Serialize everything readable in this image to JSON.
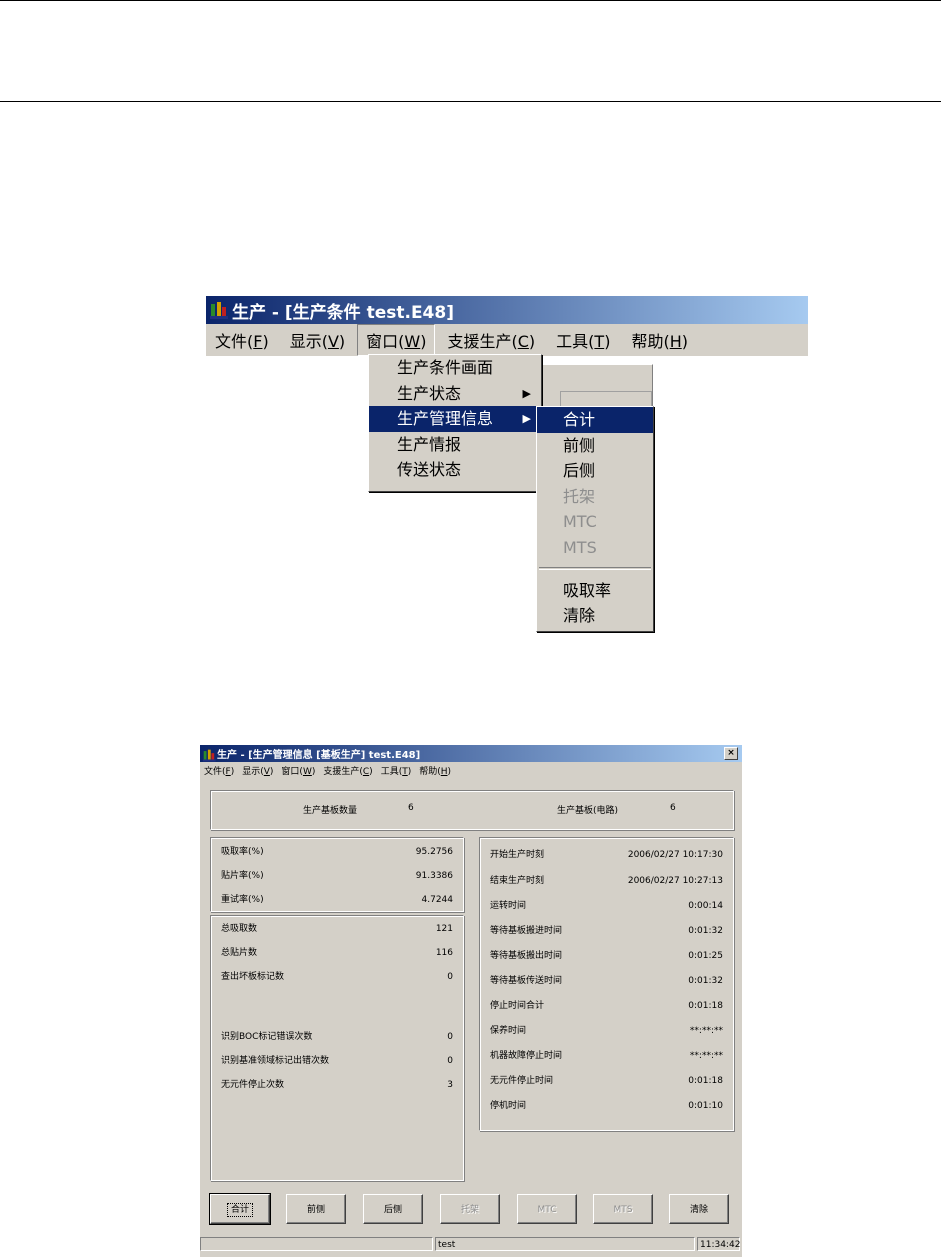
{
  "screenshot1": {
    "title": "生产 - [生产条件 test.E48]",
    "menubar": [
      {
        "label": "文件(",
        "key": "F",
        "end": ")"
      },
      {
        "label": "显示(",
        "key": "V",
        "end": ")"
      },
      {
        "label": "窗口(",
        "key": "W",
        "end": ")"
      },
      {
        "label": "支援生产(",
        "key": "C",
        "end": ")"
      },
      {
        "label": "工具(",
        "key": "T",
        "end": ")"
      },
      {
        "label": "帮助(",
        "key": "H",
        "end": ")"
      }
    ],
    "window_menu": [
      "生产条件画面",
      "生产状态",
      "生产管理信息",
      "生产情报",
      "传送状态"
    ],
    "submenu": [
      "合计",
      "前侧",
      "后侧",
      "托架",
      "MTC",
      "MTS",
      "吸取率",
      "清除"
    ]
  },
  "screenshot2": {
    "title": "生产 - [生产管理信息 [基板生产] test.E48]",
    "close": "×",
    "menubar": [
      {
        "label": "文件(",
        "key": "F",
        "end": ")"
      },
      {
        "label": "显示(",
        "key": "V",
        "end": ")"
      },
      {
        "label": "窗口(",
        "key": "W",
        "end": ")"
      },
      {
        "label": "支援生产(",
        "key": "C",
        "end": ")"
      },
      {
        "label": "工具(",
        "key": "T",
        "end": ")"
      },
      {
        "label": "帮助(",
        "key": "H",
        "end": ")"
      }
    ],
    "top": {
      "board_count_label": "生产基板数量",
      "board_count": "6",
      "board_circuit_label": "生产基板(电路)",
      "board_circuit": "6"
    },
    "rates": [
      {
        "label": "吸取率(%)",
        "value": "95.2756"
      },
      {
        "label": "贴片率(%)",
        "value": "91.3386"
      },
      {
        "label": "重试率(%)",
        "value": "4.7244"
      }
    ],
    "counts": [
      {
        "label": "总吸取数",
        "value": "121"
      },
      {
        "label": "总贴片数",
        "value": "116"
      },
      {
        "label": "查出坏板标记数",
        "value": "0"
      },
      {
        "label": "识别BOC标记错误次数",
        "value": "0"
      },
      {
        "label": "识别基准领域标记出错次数",
        "value": "0"
      },
      {
        "label": "无元件停止次数",
        "value": "3"
      }
    ],
    "times": [
      {
        "label": "开始生产时刻",
        "value": "2006/02/27 10:17:30"
      },
      {
        "label": "结束生产时刻",
        "value": "2006/02/27 10:27:13"
      },
      {
        "label": "运转时间",
        "value": "0:00:14"
      },
      {
        "label": "等待基板搬进时间",
        "value": "0:01:32"
      },
      {
        "label": "等待基板搬出时间",
        "value": "0:01:25"
      },
      {
        "label": "等待基板传送时间",
        "value": "0:01:32"
      },
      {
        "label": "停止时间合计",
        "value": "0:01:18"
      },
      {
        "label": "保养时间",
        "value": "**:**:**"
      },
      {
        "label": "机器故障停止时间",
        "value": "**:**:**"
      },
      {
        "label": "无元件停止时间",
        "value": "0:01:18"
      },
      {
        "label": "停机时间",
        "value": "0:01:10"
      }
    ],
    "buttons": [
      "合计",
      "前侧",
      "后侧",
      "托架",
      "MTC",
      "MTS",
      "清除"
    ],
    "status": {
      "left": "",
      "middle": "test",
      "right": "11:34:42"
    }
  }
}
